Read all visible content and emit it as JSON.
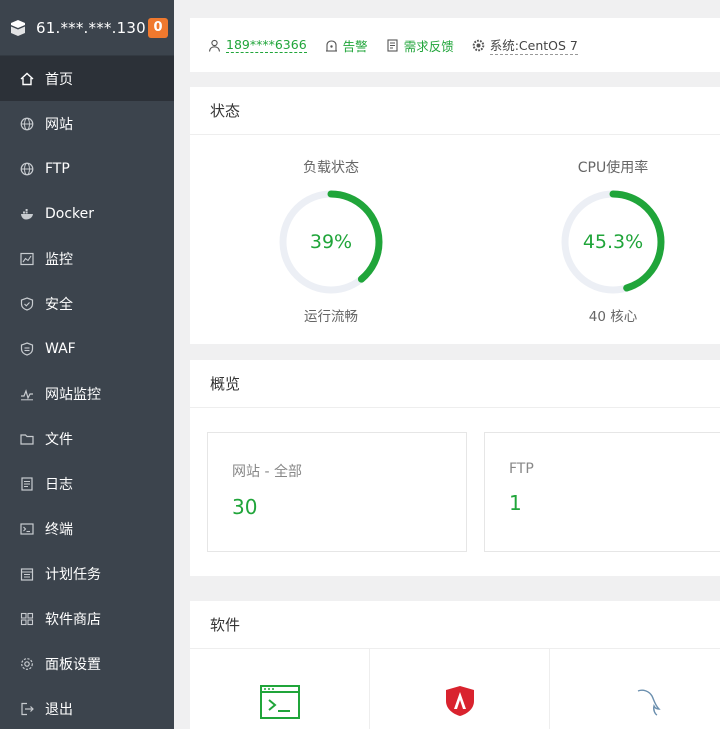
{
  "sidebar": {
    "ip": "61.***.***.130",
    "badge": "0",
    "items": [
      {
        "label": "首页",
        "icon": "home-icon"
      },
      {
        "label": "网站",
        "icon": "globe-icon"
      },
      {
        "label": "FTP",
        "icon": "globe-icon"
      },
      {
        "label": "Docker",
        "icon": "docker-icon"
      },
      {
        "label": "监控",
        "icon": "monitor-chart-icon"
      },
      {
        "label": "安全",
        "icon": "shield-icon"
      },
      {
        "label": "WAF",
        "icon": "shield-icon"
      },
      {
        "label": "网站监控",
        "icon": "wave-icon"
      },
      {
        "label": "文件",
        "icon": "folder-icon"
      },
      {
        "label": "日志",
        "icon": "log-icon"
      },
      {
        "label": "终端",
        "icon": "terminal-icon"
      },
      {
        "label": "计划任务",
        "icon": "calendar-icon"
      },
      {
        "label": "软件商店",
        "icon": "grid-icon"
      },
      {
        "label": "面板设置",
        "icon": "gear-icon"
      },
      {
        "label": "退出",
        "icon": "logout-icon"
      }
    ]
  },
  "topbar": {
    "user": "189****6366",
    "alarm": "告警",
    "feedback": "需求反馈",
    "system_label": "系统:",
    "system_value": "CentOS 7"
  },
  "status": {
    "title": "状态",
    "load": {
      "title": "负载状态",
      "value": "39%",
      "percent": 39,
      "sub": "运行流畅"
    },
    "cpu": {
      "title": "CPU使用率",
      "value": "45.3%",
      "percent": 45.3,
      "sub": "40 核心"
    }
  },
  "overview": {
    "title": "概览",
    "cards": [
      {
        "label": "网站 - 全部",
        "value": "30"
      },
      {
        "label": "FTP",
        "value": "1"
      }
    ]
  },
  "software": {
    "title": "软件"
  },
  "colors": {
    "accent": "#20a53a",
    "sidebar_bg": "#3c444d",
    "sidebar_active": "#2c3138",
    "badge": "#f0792e"
  }
}
